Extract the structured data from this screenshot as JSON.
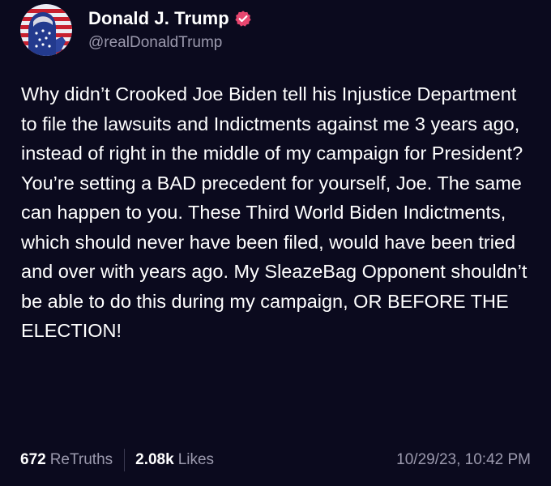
{
  "author": {
    "display_name": "Donald J. Trump",
    "handle": "@realDonaldTrump",
    "avatar_icon": "patriotic-portrait-avatar",
    "verified_icon": "verified-badge-icon",
    "verified_color": "#e8466f"
  },
  "post": {
    "text": "Why didn’t Crooked Joe Biden tell his Injustice Department to file the lawsuits and Indictments against me 3 years ago, instead of right in the middle of my campaign for President? You’re setting a BAD precedent for yourself, Joe. The same can happen to you. These Third World Biden Indictments, which should never have been filed, would have been tried and over with years ago. My SleazeBag Opponent shouldn’t be able to do this during my campaign, OR BEFORE THE ELECTION!"
  },
  "stats": {
    "retruths_count": "672",
    "retruths_label": "ReTruths",
    "likes_count": "2.08k",
    "likes_label": "Likes",
    "timestamp": "10/29/23, 10:42 PM"
  },
  "colors": {
    "background": "#0b0a1e",
    "text_primary": "#ffffff",
    "text_secondary": "#9b99ad"
  }
}
